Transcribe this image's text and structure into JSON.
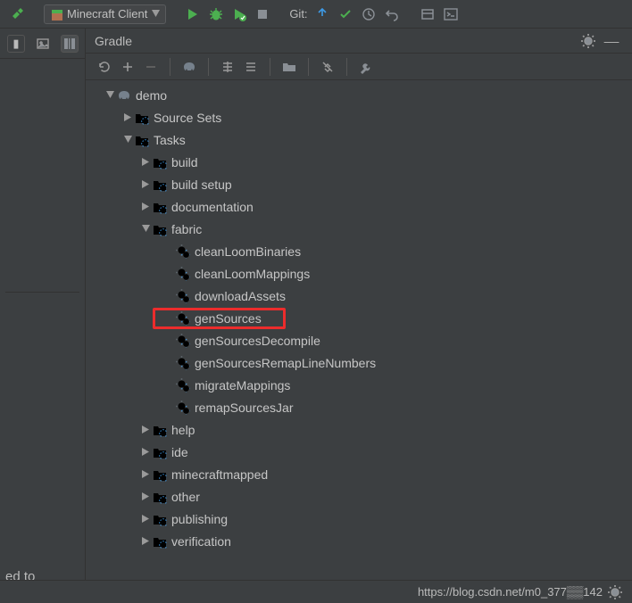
{
  "toolbar": {
    "run_config": "Minecraft Client",
    "git_label": "Git:"
  },
  "panel": {
    "title": "Gradle"
  },
  "left": {
    "cut_text": "ed to"
  },
  "tree": {
    "root": "demo",
    "source_sets": "Source Sets",
    "tasks_label": "Tasks",
    "groups": {
      "build": "build",
      "build_setup": "build setup",
      "documentation": "documentation",
      "fabric": "fabric",
      "help": "help",
      "ide": "ide",
      "minecraftmapped": "minecraftmapped",
      "other": "other",
      "publishing": "publishing",
      "verification": "verification"
    },
    "tasks": {
      "cleanLoomBinaries": "cleanLoomBinaries",
      "cleanLoomMappings": "cleanLoomMappings",
      "downloadAssets": "downloadAssets",
      "genSources": "genSources",
      "genSourcesDecompile": "genSourcesDecompile",
      "genSourcesRemapLineNumbers": "genSourcesRemapLineNumbers",
      "migrateMappings": "migrateMappings",
      "remapSourcesJar": "remapSourcesJar"
    }
  },
  "status": {
    "text": "https://blog.csdn.net/m0_377▒▒142"
  }
}
